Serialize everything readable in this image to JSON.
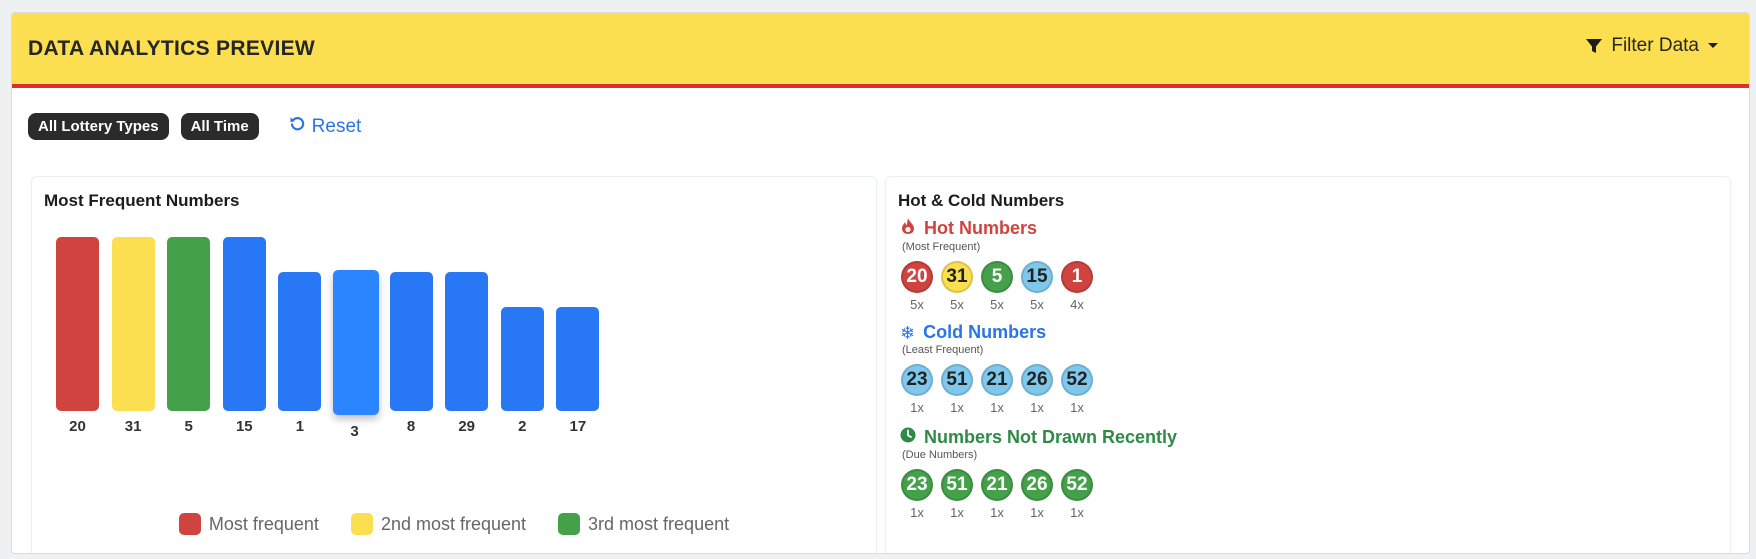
{
  "header": {
    "title": "DATA ANALYTICS PREVIEW",
    "filter_label": "Filter Data"
  },
  "filters": {
    "chips": [
      "All Lottery Types",
      "All Time"
    ],
    "reset_label": "Reset"
  },
  "frequent_panel": {
    "title": "Most Frequent Numbers",
    "legend": [
      "Most frequent",
      "2nd most frequent",
      "3rd most frequent"
    ]
  },
  "chart_data": {
    "type": "bar",
    "categories": [
      "20",
      "31",
      "5",
      "15",
      "1",
      "3",
      "8",
      "29",
      "2",
      "17"
    ],
    "values": [
      5,
      5,
      5,
      5,
      4,
      4,
      4,
      4,
      3,
      3
    ],
    "colors": [
      "#d04440",
      "#fbdf50",
      "#45a04a",
      "#2877f5",
      "#2877f5",
      "#2b85ff",
      "#2877f5",
      "#2877f5",
      "#2877f5",
      "#2877f5"
    ],
    "highlighted_category": "3",
    "legend": [
      {
        "label": "Most frequent",
        "color": "#d04440"
      },
      {
        "label": "2nd most frequent",
        "color": "#fbdf50"
      },
      {
        "label": "3rd most frequent",
        "color": "#45a04a"
      }
    ]
  },
  "hot_cold_panel": {
    "title": "Hot & Cold Numbers",
    "hot": {
      "title": "Hot Numbers",
      "subtitle": "(Most Frequent)",
      "color": "#d04440",
      "numbers": [
        {
          "n": "20",
          "count": "5x",
          "bg": "#d04440",
          "fg": "#ffffff"
        },
        {
          "n": "31",
          "count": "5x",
          "bg": "#fbdf50",
          "fg": "#222222"
        },
        {
          "n": "5",
          "count": "5x",
          "bg": "#45a04a",
          "fg": "#ffffff"
        },
        {
          "n": "15",
          "count": "5x",
          "bg": "#7fc8ec",
          "fg": "#222222"
        },
        {
          "n": "1",
          "count": "4x",
          "bg": "#d04440",
          "fg": "#ffffff"
        }
      ]
    },
    "cold": {
      "title": "Cold Numbers",
      "subtitle": "(Least Frequent)",
      "color": "#2a74e6",
      "numbers": [
        {
          "n": "23",
          "count": "1x",
          "bg": "#7fc8ec",
          "fg": "#222222"
        },
        {
          "n": "51",
          "count": "1x",
          "bg": "#7fc8ec",
          "fg": "#222222"
        },
        {
          "n": "21",
          "count": "1x",
          "bg": "#7fc8ec",
          "fg": "#222222"
        },
        {
          "n": "26",
          "count": "1x",
          "bg": "#7fc8ec",
          "fg": "#222222"
        },
        {
          "n": "52",
          "count": "1x",
          "bg": "#7fc8ec",
          "fg": "#222222"
        }
      ]
    },
    "due": {
      "title": "Numbers Not Drawn Recently",
      "subtitle": "(Due Numbers)",
      "color": "#2e8a46",
      "numbers": [
        {
          "n": "23",
          "count": "1x",
          "bg": "#45a04a",
          "fg": "#ffffff"
        },
        {
          "n": "51",
          "count": "1x",
          "bg": "#45a04a",
          "fg": "#ffffff"
        },
        {
          "n": "21",
          "count": "1x",
          "bg": "#45a04a",
          "fg": "#ffffff"
        },
        {
          "n": "26",
          "count": "1x",
          "bg": "#45a04a",
          "fg": "#ffffff"
        },
        {
          "n": "52",
          "count": "1x",
          "bg": "#45a04a",
          "fg": "#ffffff"
        }
      ]
    }
  },
  "icons": {
    "filter": "filter-icon",
    "caret": "caret-down-icon",
    "reset": "undo-icon",
    "hot": "fire-icon",
    "cold": "snowflake-icon",
    "due": "clock-icon"
  }
}
